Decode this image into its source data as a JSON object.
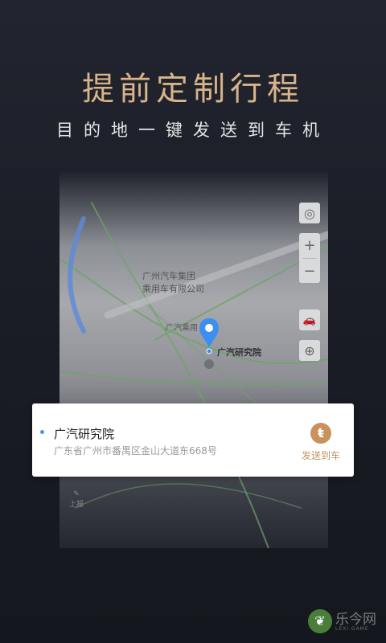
{
  "promo": {
    "headline": "提前定制行程",
    "subline": "目的地一键发送到车机"
  },
  "map": {
    "labels": [
      "广州汽车集团",
      "乘用车有限公司",
      "广汽乘用",
      "广汽研究院",
      "上报"
    ],
    "zoom_in": "+",
    "zoom_out": "−"
  },
  "card": {
    "place_name": "广汽研究院",
    "address": "广东省广州市番禺区金山大道东668号",
    "send_label": "发送到车",
    "send_icon": "car-send-icon"
  },
  "watermark": {
    "text": "乐今网",
    "sub": "LEXI GAME"
  },
  "colors": {
    "accent_gold": "#c9925c",
    "headline": "#d8b48a",
    "pin_blue": "#3b8ff0"
  }
}
